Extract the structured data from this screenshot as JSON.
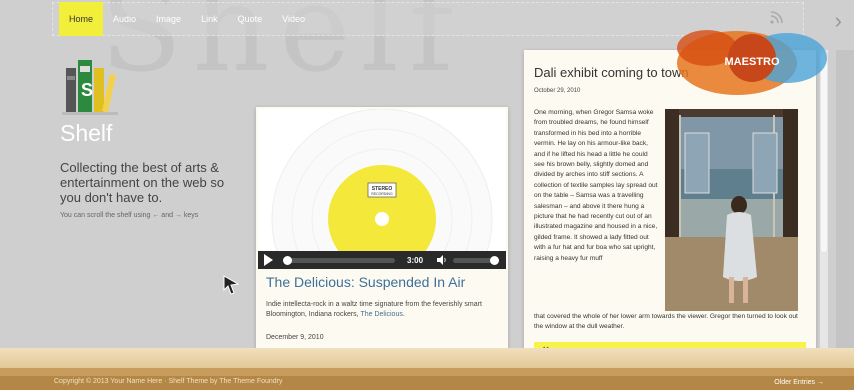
{
  "nav": {
    "items": [
      {
        "label": "Home",
        "active": true
      },
      {
        "label": "Audio",
        "active": false
      },
      {
        "label": "Image",
        "active": false
      },
      {
        "label": "Link",
        "active": false
      },
      {
        "label": "Quote",
        "active": false
      },
      {
        "label": "Video",
        "active": false
      }
    ]
  },
  "site": {
    "title": "Shelf",
    "tagline": "Collecting the best of arts & entertainment on the web so you don't have to.",
    "hint": "You can scroll the shelf using ← and → keys"
  },
  "audio_post": {
    "label_stereo": "STEREO",
    "label_recording": "RECORDING",
    "time": "3:00",
    "progress": 0,
    "volume": 1,
    "title": "The Delicious: Suspended In Air",
    "excerpt_prefix": "Indie intellecta-rock in a waltz time signature from the feverishly smart Bloomington, Indiana rockers, ",
    "excerpt_link": "The Delicious",
    "excerpt_suffix": ".",
    "date": "December 9, 2010"
  },
  "dali_post": {
    "title": "Dali exhibit coming to town",
    "date": "October 29, 2010",
    "body": "One morning, when Gregor Samsa woke from troubled dreams, he found himself transformed in his bed into a horrible vermin. He lay on his armour-like back, and if he lifted his head a little he could see his brown belly, slightly domed and divided by arches into stiff sections. A collection of textile samples lay spread out on the table – Samsa was a travelling salesman – and above it there hung a picture that he had recently cut out of an illustrated magazine and housed in a nice, gilded frame. It showed a lady fitted out with a fur hat and fur boa who sat upright, raising a heavy fur muff",
    "body_wide": "that covered the whole of her lower arm towards the viewer. Gregor then turned to look out the window at the dull weather.",
    "quote": "He must have tried it a hundred times, shut"
  },
  "badge": {
    "text": "MAESTRO"
  },
  "footer": {
    "copyright": "Copyright © 2013 Your Name Here  ·  Shelf Theme by The Theme Foundry",
    "older": "Older Entries →"
  },
  "colors": {
    "accent": "#f2ef3a",
    "link": "#3f6f9b",
    "shelf": "#e2c898"
  },
  "icons": [
    "rss-icon",
    "arrow-right-icon",
    "books-logo-icon",
    "play-icon",
    "volume-icon",
    "mouse-cursor-icon"
  ]
}
